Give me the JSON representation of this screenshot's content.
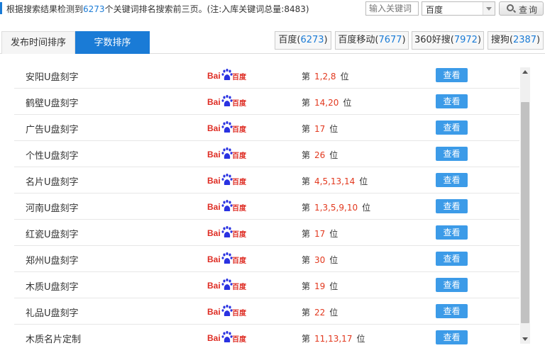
{
  "summary": {
    "prefix": "根据搜索结果检测到",
    "count": "6273",
    "middle": "个关键词排名搜索前三页。(注:入库关键词总量:",
    "total": "8483",
    "suffix": ")"
  },
  "search": {
    "placeholder": "输入关键词",
    "engine_selected": "百度",
    "query_label": "查询"
  },
  "tabs": [
    {
      "label": "发布时间排序",
      "active": false
    },
    {
      "label": "字数排序",
      "active": true
    }
  ],
  "engine_tabs": [
    {
      "name": "百度",
      "count": "6273"
    },
    {
      "name": "百度移动",
      "count": "7677"
    },
    {
      "name": "360好搜",
      "count": "7972"
    },
    {
      "name": "搜狗",
      "count": "2387"
    }
  ],
  "rank_prefix": "第",
  "rank_suffix": "位",
  "view_label": "查看",
  "logo_text": {
    "latin": "Bai",
    "cn": "百度"
  },
  "colors": {
    "accent": "#1a7bd6",
    "rank": "#e2381e",
    "button": "#3c9be8",
    "logo_red": "#de2c23",
    "logo_blue": "#2932e1"
  },
  "rows": [
    {
      "keyword": "安阳U盘刻字",
      "positions": "1,2,8"
    },
    {
      "keyword": "鹤壁U盘刻字",
      "positions": "14,20"
    },
    {
      "keyword": "广告U盘刻字",
      "positions": "17"
    },
    {
      "keyword": "个性U盘刻字",
      "positions": "26"
    },
    {
      "keyword": "名片U盘刻字",
      "positions": "4,5,13,14"
    },
    {
      "keyword": "河南U盘刻字",
      "positions": "1,3,5,9,10"
    },
    {
      "keyword": "红瓷U盘刻字",
      "positions": "17"
    },
    {
      "keyword": "郑州U盘刻字",
      "positions": "30"
    },
    {
      "keyword": "木质U盘刻字",
      "positions": "19"
    },
    {
      "keyword": "礼品U盘刻字",
      "positions": "22"
    },
    {
      "keyword": "木质名片定制",
      "positions": "11,13,17"
    }
  ]
}
